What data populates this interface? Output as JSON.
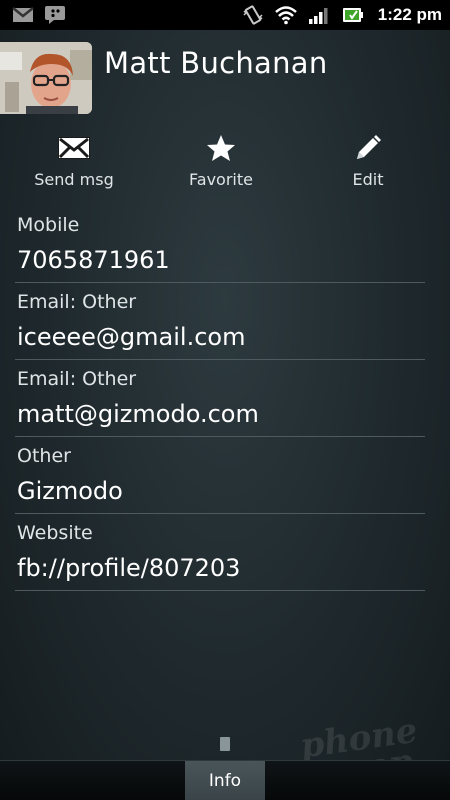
{
  "status_bar": {
    "time": "1:22 pm",
    "icons": [
      "gmail-icon",
      "bbm-icon",
      "vibrate-icon",
      "wifi-icon",
      "signal-icon",
      "battery-icon"
    ]
  },
  "contact": {
    "name": "Matt Buchanan",
    "avatar": "contact-photo"
  },
  "actions": [
    {
      "label": "Send msg",
      "icon": "envelope-icon"
    },
    {
      "label": "Favorite",
      "icon": "star-icon"
    },
    {
      "label": "Edit",
      "icon": "pencil-icon"
    }
  ],
  "fields": [
    {
      "label": "Mobile",
      "value": "7065871961"
    },
    {
      "label": "Email: Other",
      "value": "iceeee@gmail.com"
    },
    {
      "label": "Email: Other",
      "value": "matt@gizmodo.com"
    },
    {
      "label": "Other",
      "value": "Gizmodo"
    },
    {
      "label": "Website",
      "value": "fb://profile/807203"
    }
  ],
  "bottom_tabs": {
    "active": "Info"
  },
  "watermark": "phone scoop",
  "colors": {
    "background": "#1f292d",
    "divider": "#4d5a5f",
    "text": "#ffffff",
    "label": "#dfe4e6"
  }
}
